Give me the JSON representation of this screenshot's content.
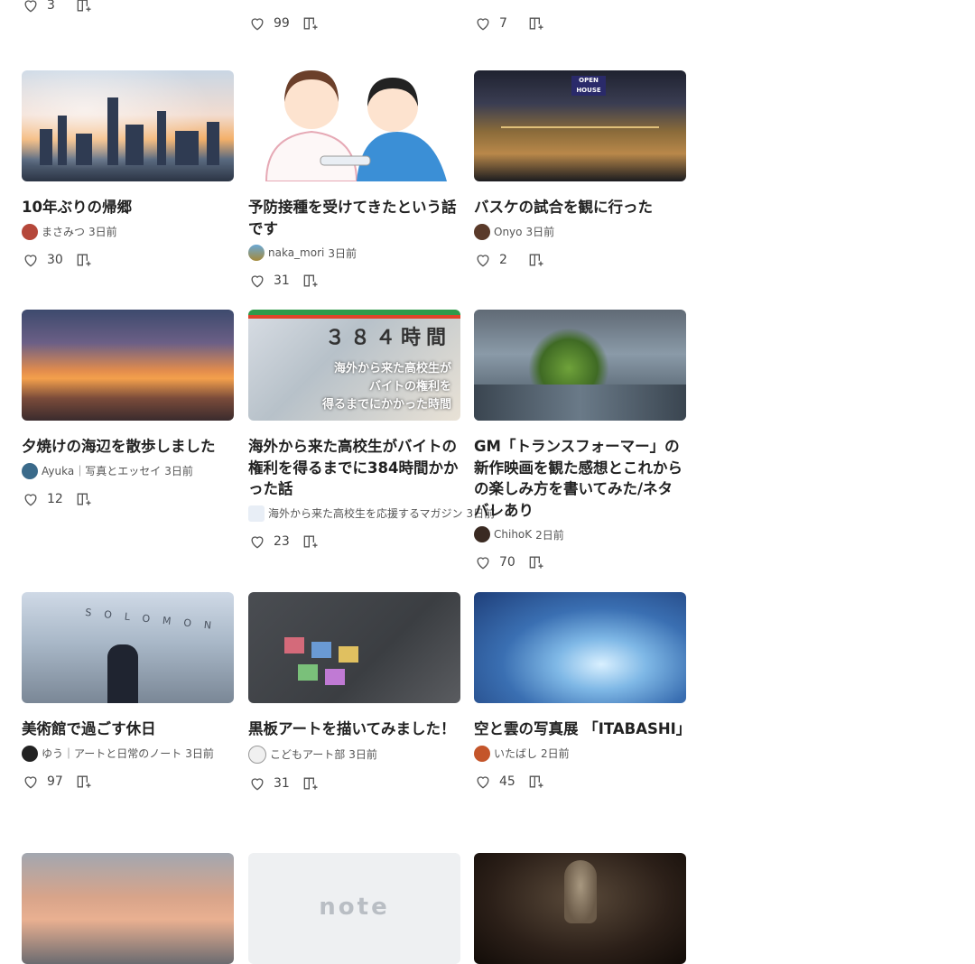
{
  "top_row": [
    {
      "likes": "3"
    },
    {
      "likes": "99"
    },
    {
      "likes": "7"
    }
  ],
  "cards": [
    {
      "title": "10年ぶりの帰郷",
      "author": "まさみつ",
      "ago": "3日前",
      "likes": "30",
      "thumb": "city-skyline-sunset"
    },
    {
      "title": "予防接種を受けてきたという話です",
      "author": "naka_mori",
      "ago": "3日前",
      "likes": "31",
      "thumb": "nurse-illustration"
    },
    {
      "title": "バスケの試合を観に行った",
      "author": "Onyo",
      "ago": "3日前",
      "likes": "2",
      "thumb": "basketball-court"
    },
    {
      "title": "夕焼けの海辺を散歩しました",
      "author": "Ayuka｜写真とエッセイ",
      "ago": "3日前",
      "likes": "12",
      "thumb": "beach-sunset"
    },
    {
      "title": "海外から来た高校生がバイトの権利を得るまでに384時間かかった話",
      "author": "海外から来た高校生を応援するマガジン",
      "ago": "3日前",
      "likes": "23",
      "thumb": "convenience-store"
    },
    {
      "title": "GM「トランスフォーマー」の新作映画を観た感想とこれからの楽しみ方を書いてみた/ネタバレあり",
      "author": "ChihoK",
      "ago": "2日前",
      "likes": "70",
      "thumb": "robot-movie"
    },
    {
      "title": "美術館で過ごす休日",
      "author": "ゆう｜アートと日常のノート",
      "ago": "3日前",
      "likes": "97",
      "thumb": "guggenheim"
    },
    {
      "title": "黒板アートを描いてみました！",
      "author": "こどもアート部",
      "ago": "3日前",
      "likes": "31",
      "thumb": "chalkboard"
    },
    {
      "title": "空と雲の写真展 「ITABASHI」",
      "author": "いたばし",
      "ago": "2日前",
      "likes": "45",
      "thumb": "sky-clouds"
    }
  ],
  "bottom_row": [
    {
      "thumb": "evening-sky"
    },
    {
      "thumb": "note-placeholder",
      "logo": "note"
    },
    {
      "thumb": "buddha-statue"
    }
  ],
  "store_overlay": {
    "line1": "３８４時間",
    "line2": "海外から来た高校生が",
    "line3": "バイトの権利を",
    "line4": "得るまでにかかった時間"
  },
  "court_sign": "OPEN HOUSE",
  "museum_sign": "SOLOMON",
  "colors": {
    "accent": "#2cb696",
    "icon": "#555555"
  }
}
